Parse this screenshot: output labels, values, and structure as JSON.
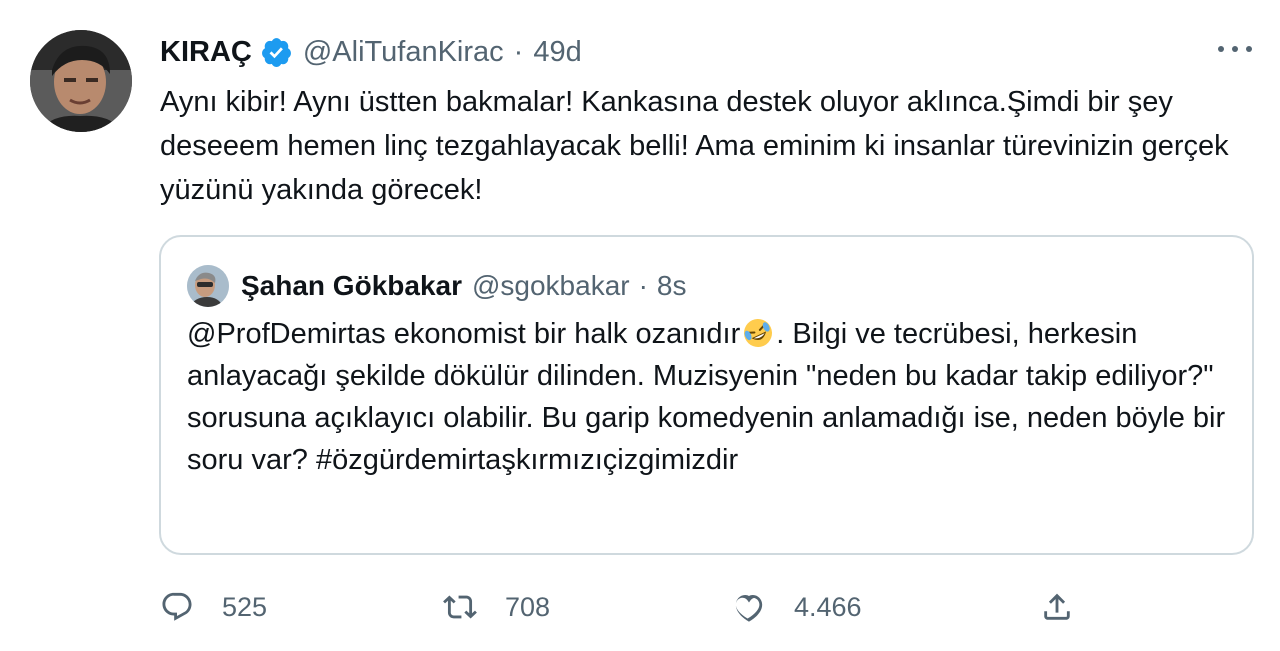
{
  "tweet": {
    "author": {
      "name": "KIRAÇ",
      "handle": "@AliTufanKirac",
      "time": "49d",
      "avatar_icon": "profile-photo",
      "verified_icon": "verified-badge-icon"
    },
    "separator": "·",
    "text": "Aynı kibir! Aynı üstten bakmalar! Kankasına destek oluyor aklınca.Şimdi bir şey deseeem hemen linç tezgahlayacak belli! Ama eminim ki insanlar türevinizin gerçek yüzünü yakında görecek!",
    "quote": {
      "author": {
        "name": "Şahan Gökbakar",
        "handle": "@sgokbakar",
        "time": "8s",
        "avatar_icon": "profile-photo"
      },
      "text_before_emoji": "@ProfDemirtas ekonomist bir halk ozanıdır",
      "emoji": "rolling-on-floor-laughing-emoji",
      "text_after_emoji": ". Bilgi ve tecrübesi, herkesin anlayacağı şekilde dökülür dilinden. Muzisyenin \"neden bu kadar takip ediliyor?\" sorusuna açıklayıcı olabilir. Bu garip komedyenin anlamadığı ise, neden böyle bir soru var? #özgürdemirtaşkırmızıçizgimizdir"
    },
    "actions": {
      "reply_count": "525",
      "retweet_count": "708",
      "like_count": "4.466",
      "reply_icon": "reply-icon",
      "retweet_icon": "retweet-icon",
      "like_icon": "heart-icon",
      "share_icon": "share-icon",
      "more_icon": "more-options-icon"
    },
    "colors": {
      "verified": "#1d9bf0",
      "secondary_text": "#536471",
      "border": "#cfd9de"
    }
  }
}
